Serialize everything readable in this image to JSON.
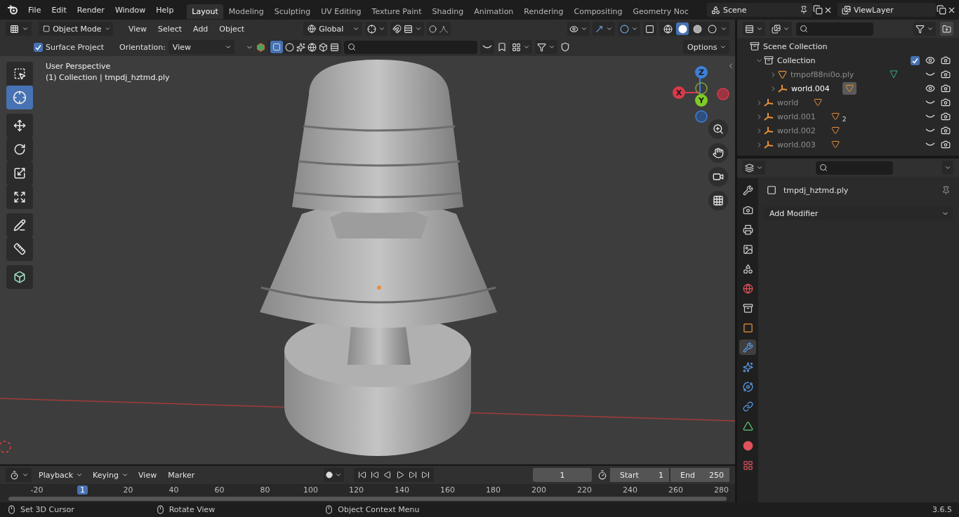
{
  "menu": [
    {
      "label": "File"
    },
    {
      "label": "Edit"
    },
    {
      "label": "Render"
    },
    {
      "label": "Window"
    },
    {
      "label": "Help"
    }
  ],
  "workspaces": [
    {
      "label": "Layout",
      "selected": true
    },
    {
      "label": "Modeling",
      "selected": false
    },
    {
      "label": "Sculpting",
      "selected": false
    },
    {
      "label": "UV Editing",
      "selected": false
    },
    {
      "label": "Texture Paint",
      "selected": false
    },
    {
      "label": "Shading",
      "selected": false
    },
    {
      "label": "Animation",
      "selected": false
    },
    {
      "label": "Rendering",
      "selected": false
    },
    {
      "label": "Compositing",
      "selected": false
    },
    {
      "label": "Geometry Noc",
      "selected": false
    }
  ],
  "scene": "Scene",
  "view_layer": "ViewLayer",
  "viewport_header": {
    "mode": "Object Mode",
    "menus": [
      "View",
      "Select",
      "Add",
      "Object"
    ],
    "orientation": "Global"
  },
  "tool_settings": {
    "surface_project": {
      "label": "Surface Project",
      "checked": true
    },
    "orientation_label": "Orientation:",
    "orientation_value": "View",
    "options": "Options"
  },
  "viewport": {
    "info": [
      "User Perspective",
      "(1) Collection | tmpdj_hztmd.ply"
    ],
    "tools": [
      {
        "kind": "select",
        "selected": false
      },
      {
        "kind": "cursor",
        "selected": true
      },
      {
        "kind": "move",
        "selected": false
      },
      {
        "kind": "rotate",
        "selected": false
      },
      {
        "kind": "scale",
        "selected": false
      },
      {
        "kind": "transform",
        "selected": false
      },
      {
        "kind": "annotate",
        "selected": false
      },
      {
        "kind": "measure",
        "selected": false
      },
      {
        "kind": "add-cube",
        "selected": false
      }
    ],
    "axes": {
      "z": "Z",
      "x": "X",
      "y": "Y"
    }
  },
  "outliner": {
    "items": [
      {
        "label": "Scene Collection",
        "kind": "scene-collection",
        "children": [
          {
            "label": "Collection",
            "kind": "collection",
            "expanded": true,
            "checked": true,
            "visible": true,
            "active": false,
            "children": [
              {
                "label": "tmpof88ni0o.ply",
                "kind": "mesh",
                "expanded": false,
                "visible": false,
                "active": false
              },
              {
                "label": "world.004",
                "kind": "empty",
                "expanded": false,
                "visible": true,
                "active": true
              }
            ]
          },
          {
            "label": "world",
            "kind": "empty",
            "expanded": false,
            "visible": false,
            "active": false
          },
          {
            "label": "world.001",
            "kind": "empty",
            "expanded": false,
            "visible": false,
            "active": false,
            "badge": "2"
          },
          {
            "label": "world.002",
            "kind": "empty",
            "expanded": false,
            "visible": false,
            "active": false
          },
          {
            "label": "world.003",
            "kind": "empty",
            "expanded": false,
            "visible": false,
            "active": false
          }
        ]
      }
    ]
  },
  "properties": {
    "object_name": "tmpdj_hztmd.ply",
    "add_modifier": "Add Modifier",
    "tabs": [
      {
        "kind": "tool",
        "selected": false
      },
      {
        "kind": "render",
        "selected": false
      },
      {
        "kind": "output",
        "selected": false
      },
      {
        "kind": "view-layer",
        "selected": false
      },
      {
        "kind": "scene",
        "selected": false
      },
      {
        "kind": "world",
        "selected": false
      },
      {
        "kind": "collection",
        "selected": false
      },
      {
        "kind": "object",
        "selected": false
      },
      {
        "kind": "modifier",
        "selected": true
      },
      {
        "kind": "particles",
        "selected": false
      },
      {
        "kind": "physics",
        "selected": false
      },
      {
        "kind": "constraints",
        "selected": false
      },
      {
        "kind": "data",
        "selected": false
      },
      {
        "kind": "material",
        "selected": false
      },
      {
        "kind": "texture",
        "selected": false
      }
    ]
  },
  "timeline": {
    "menus": [
      "Playback",
      "Keying",
      "View",
      "Marker"
    ],
    "current_frame": "1",
    "start_label": "Start",
    "start": "1",
    "end_label": "End",
    "end": "250",
    "ruler": [
      {
        "label": "-20",
        "current": false
      },
      {
        "label": "1",
        "current": true
      },
      {
        "label": "20",
        "current": false
      },
      {
        "label": "40",
        "current": false
      },
      {
        "label": "60",
        "current": false
      },
      {
        "label": "80",
        "current": false
      },
      {
        "label": "100",
        "current": false
      },
      {
        "label": "120",
        "current": false
      },
      {
        "label": "140",
        "current": false
      },
      {
        "label": "160",
        "current": false
      },
      {
        "label": "180",
        "current": false
      },
      {
        "label": "200",
        "current": false
      },
      {
        "label": "220",
        "current": false
      },
      {
        "label": "240",
        "current": false
      },
      {
        "label": "260",
        "current": false
      },
      {
        "label": "280",
        "current": false
      }
    ]
  },
  "status_bar": {
    "hints": [
      "Set 3D Cursor",
      "Rotate View",
      "Object Context Menu"
    ],
    "version": "3.6.5"
  }
}
